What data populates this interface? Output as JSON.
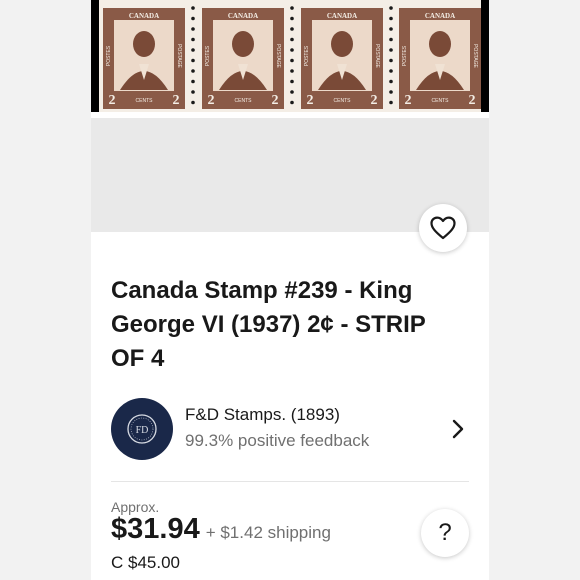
{
  "listing": {
    "image_alt": "Strip of four brown King George VI 2 cent Canada stamps",
    "stamp_text": {
      "country": "CANADA",
      "postes": "POSTES",
      "postage": "POSTAGE",
      "value": "2",
      "cents": "CENTS"
    },
    "title": "Canada Stamp #239 - King George VI (1937) 2¢ - STRIP OF 4",
    "colors": {
      "stamp_brown": "#8a5a47",
      "page_background": "#f2f2f2",
      "sheet_background": "#ffffff"
    }
  },
  "seller": {
    "avatar_icon": "fd-logo-icon",
    "avatar_initials": "FD",
    "name": "F&D Stamps. (1893)",
    "feedback": "99.3% positive feedback"
  },
  "pricing": {
    "approx_label": "Approx.",
    "price": "$31.94",
    "shipping": "+ $1.42 shipping",
    "original_price": "C $45.00"
  },
  "actions": {
    "watch_icon": "heart-icon",
    "help_label": "?"
  }
}
